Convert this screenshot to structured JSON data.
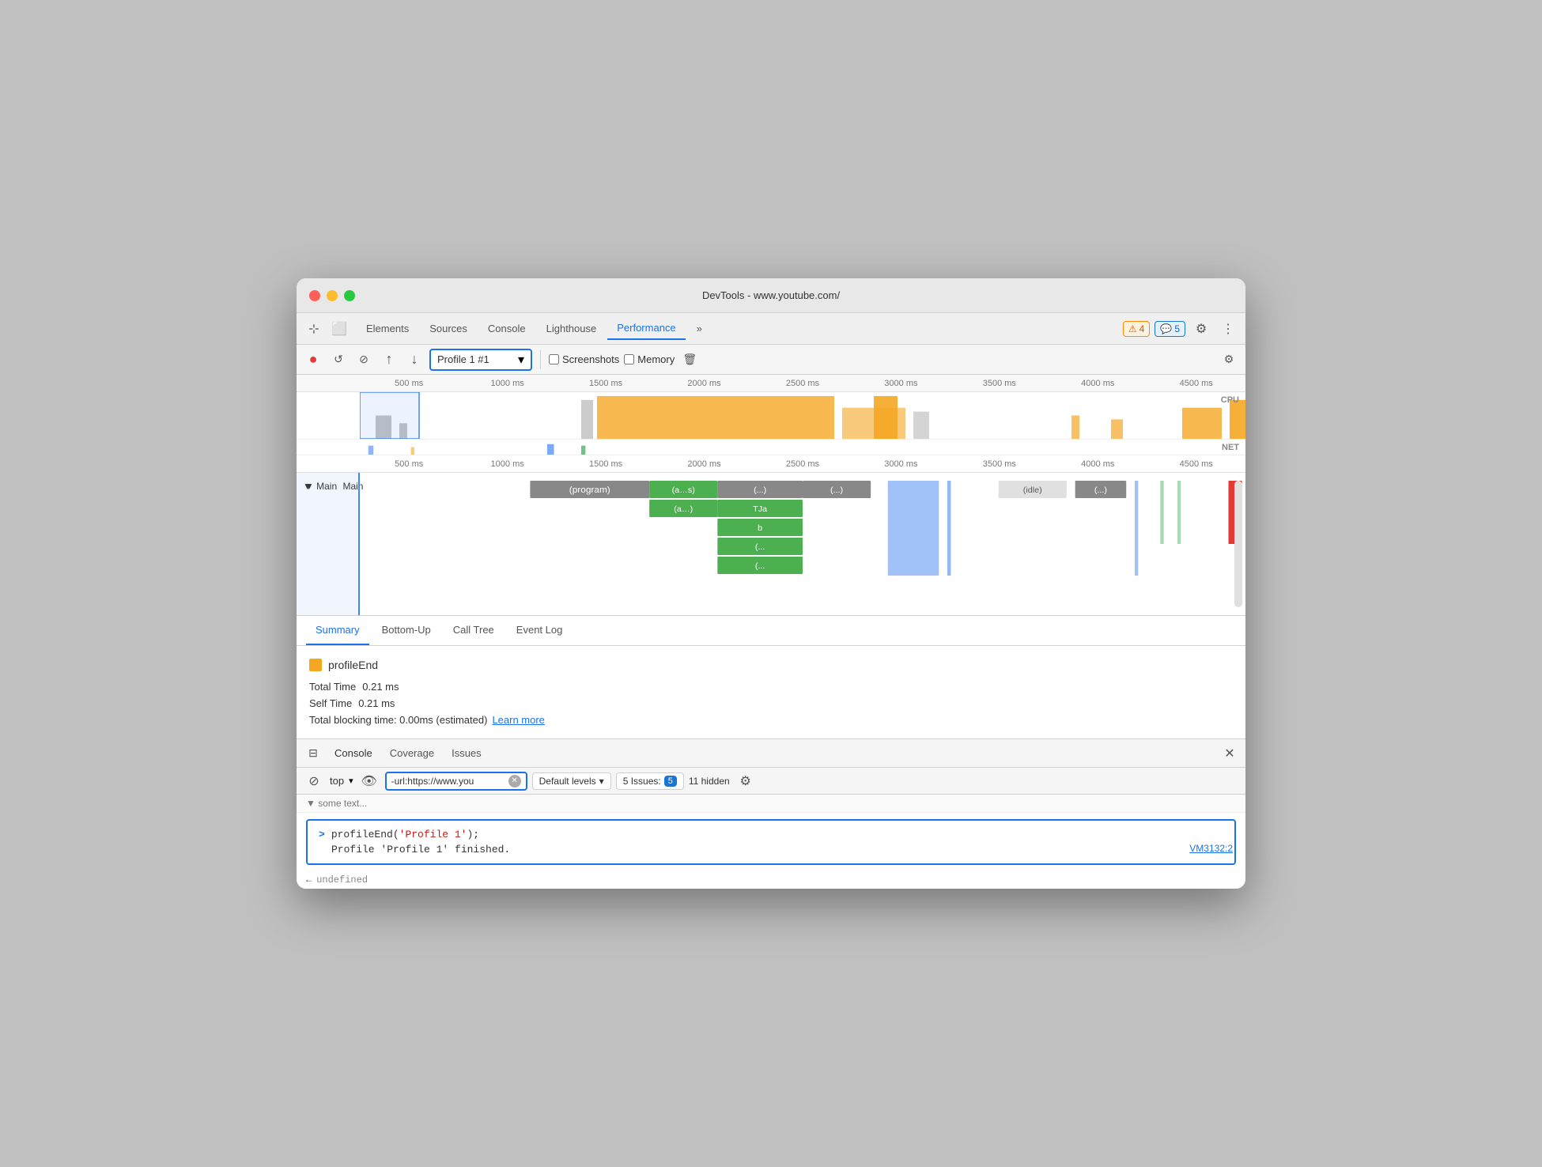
{
  "window": {
    "title": "DevTools - www.youtube.com/"
  },
  "tabs": {
    "items": [
      "Elements",
      "Sources",
      "Console",
      "Lighthouse",
      "Performance"
    ],
    "active": "Performance",
    "more": "»"
  },
  "badges": {
    "warning": {
      "icon": "⚠",
      "count": "4"
    },
    "info": {
      "icon": "💬",
      "count": "5"
    }
  },
  "toolbar": {
    "record_label": "●",
    "refresh_label": "↺",
    "stop_label": "⊘",
    "upload_label": "↑",
    "download_label": "↓",
    "profile_name": "Profile 1 #1",
    "screenshots_label": "Screenshots",
    "memory_label": "Memory",
    "delete_label": "🗑",
    "settings_label": "⚙"
  },
  "timeline": {
    "ruler_ticks": [
      "500 ms",
      "1000 ms",
      "1500 ms",
      "2000 ms",
      "2500 ms",
      "3000 ms",
      "3500 ms",
      "4000 ms",
      "4500 ms"
    ],
    "cpu_label": "CPU",
    "net_label": "NET"
  },
  "flame": {
    "main_label": "▼ Main",
    "tasks": [
      {
        "label": "(program)",
        "color": "#888",
        "level": 0
      },
      {
        "label": "(a…s)",
        "color": "#4caf50",
        "level": 0
      },
      {
        "label": "(...)",
        "color": "#4caf50",
        "level": 0
      },
      {
        "label": "(...)",
        "color": "#4caf50",
        "level": 0
      },
      {
        "label": "(idle)",
        "color": "#e0e0e0",
        "level": 0
      }
    ]
  },
  "summary": {
    "tabs": [
      "Summary",
      "Bottom-Up",
      "Call Tree",
      "Event Log"
    ],
    "active_tab": "Summary",
    "profile_icon_color": "#f5a623",
    "profile_name": "profileEnd",
    "total_time_label": "Total Time",
    "total_time_value": "0.21 ms",
    "self_time_label": "Self Time",
    "self_time_value": "0.21 ms",
    "blocking_text": "Total blocking time: 0.00ms (estimated)",
    "learn_more_label": "Learn more"
  },
  "console_panel": {
    "header_tabs": [
      "Console",
      "Coverage",
      "Issues"
    ],
    "active_tab": "Console",
    "close_label": "✕",
    "sidebar_icon": "⊟",
    "stop_icon": "⊘",
    "context_label": "top",
    "eye_icon": "👁",
    "filter_value": "-url:https://www.you",
    "levels_label": "Default levels",
    "issues_label": "5 Issues:",
    "issues_count": "5",
    "hidden_label": "11 hidden",
    "settings_icon": "⚙"
  },
  "console_output": {
    "truncated": "▼ some text...",
    "command": "profileEnd('Profile 1');",
    "command_arg": "'Profile 1'",
    "output_line": "Profile 'Profile 1' finished.",
    "vm_link": "VM3132:2",
    "undefined_line": "← undefined"
  }
}
